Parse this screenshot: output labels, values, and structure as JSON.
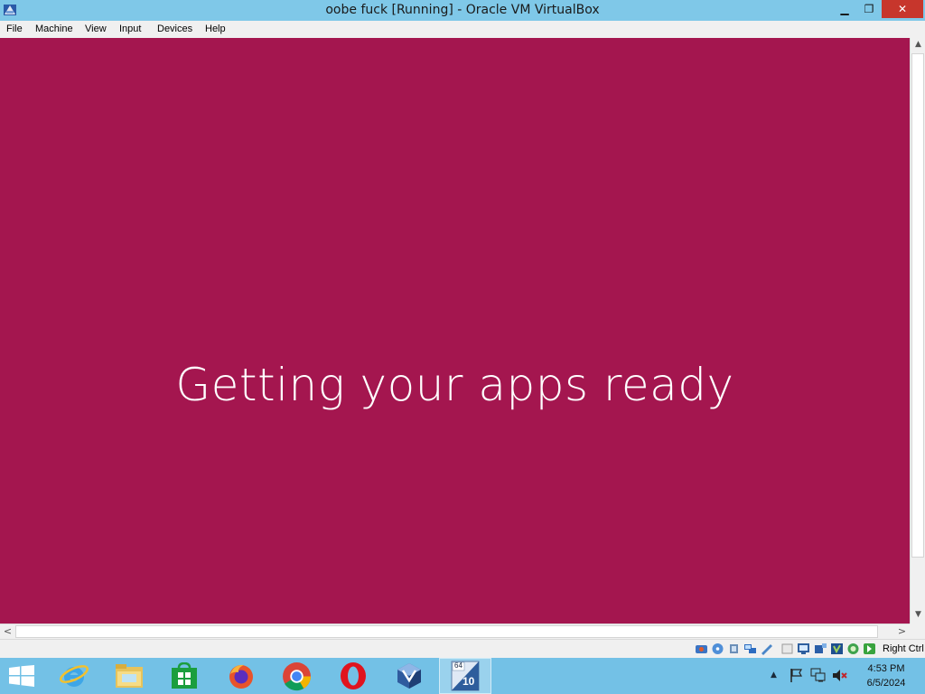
{
  "window": {
    "title": "oobe fuck [Running] - Oracle VM VirtualBox",
    "controls": {
      "minimize": "▁",
      "restore": "❐",
      "close": "✕"
    }
  },
  "menu": {
    "items": [
      "File",
      "Machine",
      "View",
      "Input",
      "Devices",
      "Help"
    ]
  },
  "vm": {
    "message": "Getting your apps ready",
    "background_color": "#a4164f"
  },
  "scrollbars": {
    "up": "▲",
    "down": "▼",
    "left": "<",
    "right": ">"
  },
  "statusbar": {
    "icons": [
      "hard-disk-icon",
      "optical-drive-icon",
      "audio-icon",
      "network-icon",
      "usb-icon",
      "shared-folders-icon",
      "display-icon",
      "video-capture-icon",
      "cpu-icon",
      "guest-additions-icon",
      "mouse-integration-icon"
    ],
    "host_key": "Right Ctrl"
  },
  "taskbar": {
    "apps": [
      "start-icon",
      "internet-explorer-icon",
      "file-explorer-icon",
      "store-icon",
      "firefox-icon",
      "chrome-icon",
      "opera-icon",
      "virtualbox-icon",
      "windows10-vm-icon"
    ],
    "active_app": "windows10-vm-icon",
    "vm_badge_top": "64",
    "vm_badge_number": "10",
    "tray": {
      "show_hidden": "▲"
    },
    "clock": {
      "time": "4:53 PM",
      "date": "6/5/2024"
    }
  }
}
